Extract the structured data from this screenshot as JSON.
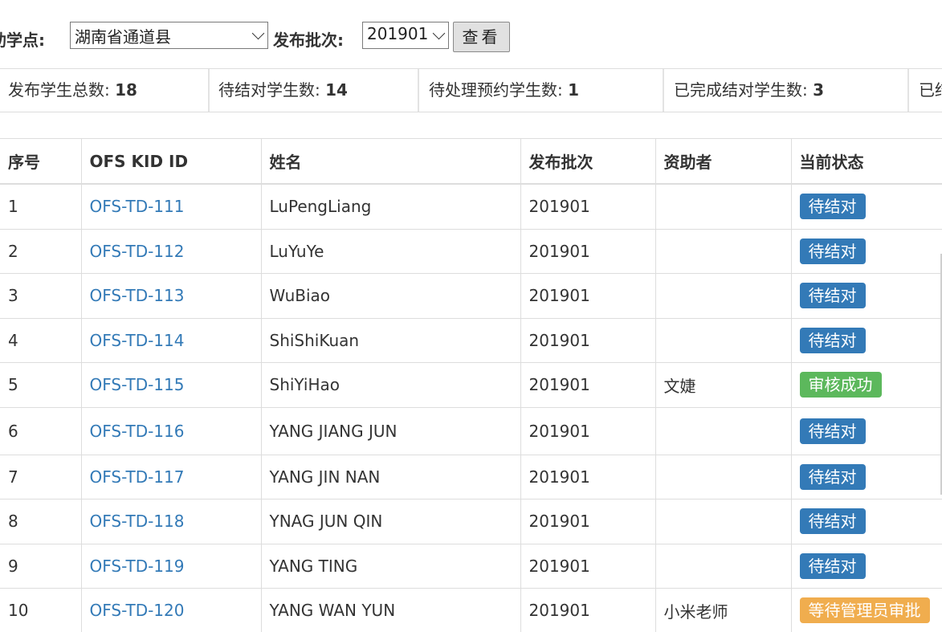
{
  "filters": {
    "site_label": "助学点:",
    "site_value": "湖南省通道县",
    "batch_label": "发布批次:",
    "batch_value": "201901",
    "view_button": "查看"
  },
  "stats": [
    {
      "label": "发布学生总数: ",
      "value": "18"
    },
    {
      "label": "待结对学生数: ",
      "value": "14"
    },
    {
      "label": "待处理预约学生数: ",
      "value": "1"
    },
    {
      "label": "已完成结对学生数: ",
      "value": "3"
    },
    {
      "label": "已结",
      "value": ""
    }
  ],
  "table": {
    "headers": [
      "序号",
      "OFS KID ID",
      "姓名",
      "发布批次",
      "资助者",
      "当前状态"
    ],
    "rows": [
      {
        "no": "1",
        "id": "OFS-TD-111",
        "name": "LuPengLiang",
        "batch": "201901",
        "sponsor": "",
        "status": "待结对"
      },
      {
        "no": "2",
        "id": "OFS-TD-112",
        "name": "LuYuYe",
        "batch": "201901",
        "sponsor": "",
        "status": "待结对"
      },
      {
        "no": "3",
        "id": "OFS-TD-113",
        "name": "WuBiao",
        "batch": "201901",
        "sponsor": "",
        "status": "待结对"
      },
      {
        "no": "4",
        "id": "OFS-TD-114",
        "name": "ShiShiKuan",
        "batch": "201901",
        "sponsor": "",
        "status": "待结对"
      },
      {
        "no": "5",
        "id": "OFS-TD-115",
        "name": "ShiYiHao",
        "batch": "201901",
        "sponsor": "文婕",
        "status": "审核成功"
      },
      {
        "no": "6",
        "id": "OFS-TD-116",
        "name": "YANG JIANG JUN",
        "batch": "201901",
        "sponsor": "",
        "status": "待结对"
      },
      {
        "no": "7",
        "id": "OFS-TD-117",
        "name": "YANG JIN NAN",
        "batch": "201901",
        "sponsor": "",
        "status": "待结对"
      },
      {
        "no": "8",
        "id": "OFS-TD-118",
        "name": "YNAG JUN QIN",
        "batch": "201901",
        "sponsor": "",
        "status": "待结对"
      },
      {
        "no": "9",
        "id": "OFS-TD-119",
        "name": "YANG TING",
        "batch": "201901",
        "sponsor": "",
        "status": "待结对"
      },
      {
        "no": "10",
        "id": "OFS-TD-120",
        "name": "YANG WAN YUN",
        "batch": "201901",
        "sponsor": "小米老师",
        "status": "等待管理员审批"
      }
    ]
  },
  "status_colors": {
    "待结对": "#337ab7",
    "审核成功": "#5cb85c",
    "等待管理员审批": "#f0ad4e"
  }
}
